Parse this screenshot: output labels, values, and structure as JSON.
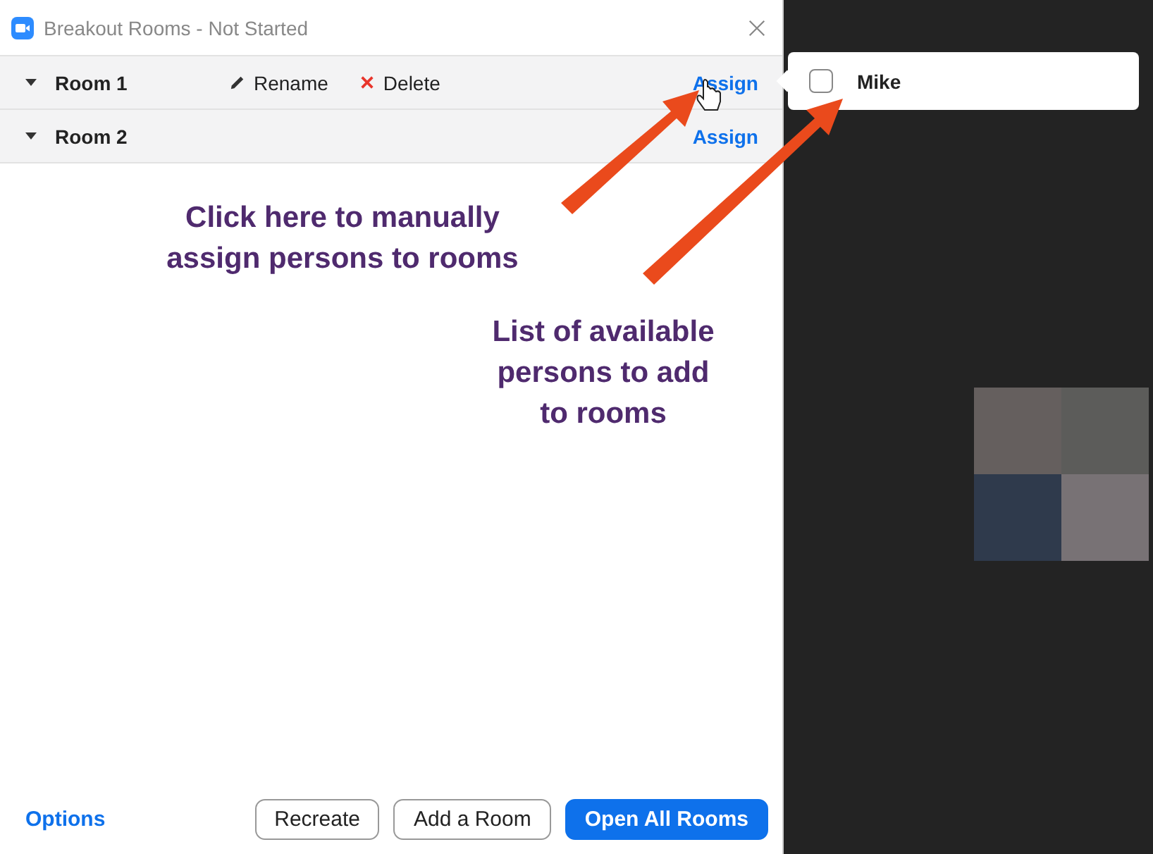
{
  "window": {
    "title": "Breakout Rooms - Not Started"
  },
  "rooms": [
    {
      "name": "Room 1",
      "actions": [
        {
          "kind": "rename",
          "label": "Rename"
        },
        {
          "kind": "delete",
          "label": "Delete"
        }
      ],
      "assign": "Assign"
    },
    {
      "name": "Room 2",
      "assign": "Assign"
    }
  ],
  "popup": {
    "participants": [
      {
        "name": "Mike",
        "checked": false
      }
    ]
  },
  "annotations": [
    "Click here to manually\nassign persons to rooms",
    "List of available\npersons to add\nto rooms"
  ],
  "footer": {
    "options": "Options",
    "buttons": [
      {
        "label": "Recreate",
        "kind": "secondary"
      },
      {
        "label": "Add a Room",
        "kind": "secondary"
      },
      {
        "label": "Open All Rooms",
        "kind": "primary"
      }
    ]
  },
  "video": {
    "kind": "picture"
  }
}
